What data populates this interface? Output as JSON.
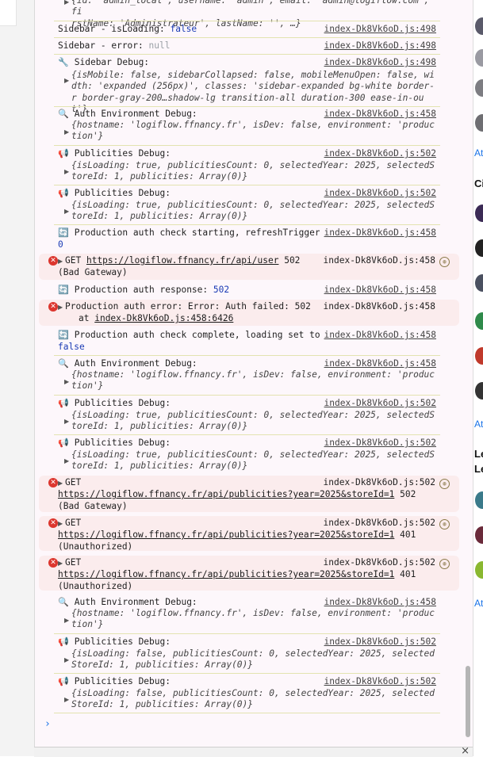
{
  "source_file": "index-Dk8Vk6oD.js",
  "top_partial": {
    "line1": "{id: 'admin_local', username: 'admin', email: 'admin@logiflow.com', fi",
    "line2": "rstName: 'Administrateur', lastName: '', …}"
  },
  "messages": [
    {
      "id": "m1",
      "text": "Sidebar - isLoading: ",
      "value": "false",
      "src": "index-Dk8Vk6oD.js:498"
    },
    {
      "id": "m2",
      "text": "Sidebar - error: ",
      "value": "null",
      "src": "index-Dk8Vk6oD.js:498"
    },
    {
      "id": "m3",
      "emoji": "🔧",
      "text": "Sidebar Debug:",
      "src": "index-Dk8Vk6oD.js:498",
      "obj": "{isMobile: false, sidebarCollapsed: false, mobileMenuOpen: false, width: 'expanded (256px)', classes: 'sidebar-expanded bg-white border-r border-gray-200…shadow-lg transition-all duration-300 ease-in-out'}"
    },
    {
      "id": "m4",
      "emoji": "🔍",
      "text": "Auth Environment Debug:",
      "src": "index-Dk8Vk6oD.js:458",
      "obj": "{hostname: 'logiflow.ffnancy.fr', isDev: false, environment: 'production'}"
    },
    {
      "id": "m5",
      "emoji": "📢",
      "text": "Publicities Debug:",
      "src": "index-Dk8Vk6oD.js:502",
      "obj": "{isLoading: true, publicitiesCount: 0, selectedYear: 2025, selectedStoreId: 1, publicities: Array(0)}"
    },
    {
      "id": "m6",
      "emoji": "📢",
      "text": "Publicities Debug:",
      "src": "index-Dk8Vk6oD.js:502",
      "obj": "{isLoading: true, publicitiesCount: 0, selectedYear: 2025, selectedStoreId: 1, publicities: Array(0)}"
    },
    {
      "id": "m7",
      "emoji": "🔄",
      "text": "Production auth check starting, refreshTrigger:",
      "value": "0",
      "src": "index-Dk8Vk6oD.js:458"
    },
    {
      "id": "e1",
      "error": true,
      "text": "GET",
      "url": "https://logiflow.ffnancy.fr/api/user",
      "status": "502",
      "status_text": "(Bad Gateway)",
      "src": "index-Dk8Vk6oD.js:458"
    },
    {
      "id": "m8",
      "emoji": "🔄",
      "text": "Production auth response: ",
      "value": "502",
      "src": "index-Dk8Vk6oD.js:458"
    },
    {
      "id": "e2",
      "error": true,
      "text": "Production auth error: Error: Auth failed: 502",
      "at": "at ",
      "at_link": "index-Dk8Vk6oD.js:458:6426",
      "src": "index-Dk8Vk6oD.js:458"
    },
    {
      "id": "m9",
      "emoji": "🔄",
      "text": "Production auth check complete, loading set to",
      "value": "false",
      "src": "index-Dk8Vk6oD.js:458"
    },
    {
      "id": "m10",
      "emoji": "🔍",
      "text": "Auth Environment Debug:",
      "src": "index-Dk8Vk6oD.js:458",
      "obj": "{hostname: 'logiflow.ffnancy.fr', isDev: false, environment: 'production'}"
    },
    {
      "id": "m11",
      "emoji": "📢",
      "text": "Publicities Debug:",
      "src": "index-Dk8Vk6oD.js:502",
      "obj": "{isLoading: true, publicitiesCount: 0, selectedYear: 2025, selectedStoreId: 1, publicities: Array(0)}"
    },
    {
      "id": "m12",
      "emoji": "📢",
      "text": "Publicities Debug:",
      "src": "index-Dk8Vk6oD.js:502",
      "obj": "{isLoading: true, publicitiesCount: 0, selectedYear: 2025, selectedStoreId: 1, publicities: Array(0)}"
    },
    {
      "id": "e3",
      "error": true,
      "text": "GET",
      "url": "https://logiflow.ffnancy.fr/api/publicities?year=2025&storeId=1",
      "status": "502",
      "status_text": "(Bad Gateway)",
      "src": "index-Dk8Vk6oD.js:502"
    },
    {
      "id": "e4",
      "error": true,
      "text": "GET",
      "url": "https://logiflow.ffnancy.fr/api/publicities?year=2025&storeId=1",
      "status": "401",
      "status_text": "(Unauthorized)",
      "src": "index-Dk8Vk6oD.js:502"
    },
    {
      "id": "e5",
      "error": true,
      "text": "GET",
      "url": "https://logiflow.ffnancy.fr/api/publicities?year=2025&storeId=1",
      "status": "401",
      "status_text": "(Unauthorized)",
      "src": "index-Dk8Vk6oD.js:502"
    },
    {
      "id": "m13",
      "emoji": "🔍",
      "text": "Auth Environment Debug:",
      "src": "index-Dk8Vk6oD.js:458",
      "obj": "{hostname: 'logiflow.ffnancy.fr', isDev: false, environment: 'production'}"
    },
    {
      "id": "m14",
      "emoji": "📢",
      "text": "Publicities Debug:",
      "src": "index-Dk8Vk6oD.js:502",
      "obj": "{isLoading: false, publicitiesCount: 0, selectedYear: 2025, selectedStoreId: 1, publicities: Array(0)}"
    },
    {
      "id": "m15",
      "emoji": "📢",
      "text": "Publicities Debug:",
      "src": "index-Dk8Vk6oD.js:502",
      "obj": "{isLoading: false, publicitiesCount: 0, selectedYear: 2025, selectedStoreId: 1, publicities: Array(0)}"
    }
  ],
  "prompt_symbol": "›",
  "right_panel": {
    "labels": [
      "At",
      "Ci",
      "At",
      "Le",
      "Le",
      "At"
    ]
  },
  "colors": {
    "error_bg": "#fbeced",
    "error_icon": "#dc362e",
    "console_bg": "#fdf7fb"
  }
}
